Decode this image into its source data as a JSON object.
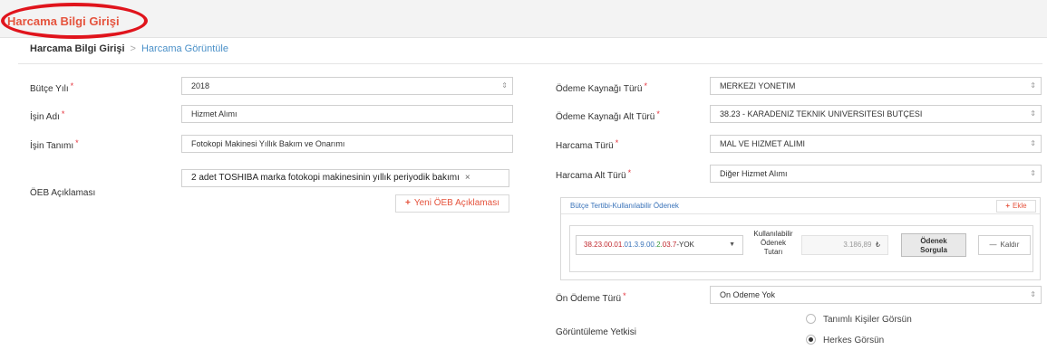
{
  "header": {
    "title": "Harcama Bilgi Girişi"
  },
  "breadcrumb": {
    "main": "Harcama Bilgi Girişi",
    "separator": ">",
    "current": "Harcama Görüntüle"
  },
  "required_mark": "*",
  "left_form": {
    "butce_yili": {
      "label": "Bütçe Yılı",
      "value": "2018"
    },
    "isin_adi": {
      "label": "İşin Adı",
      "value": "Hizmet Alımı"
    },
    "isin_tanimi": {
      "label": "İşin Tanımı",
      "value": "Fotokopi Makinesi Yıllık Bakım ve Onarımı"
    },
    "oeb": {
      "label": "ÖEB Açıklaması",
      "tag_text": "2 adet TOSHIBA marka fotokopi makinesinin yıllık periyodik bakımı",
      "tag_remove": "×",
      "new_button_plus": "+",
      "new_button_label": "Yeni ÖEB Açıklaması"
    }
  },
  "right_form": {
    "odeme_kaynagi_turu": {
      "label": "Ödeme Kaynağı Türü",
      "value": "MERKEZI YONETIM"
    },
    "odeme_kaynagi_alt_turu": {
      "label": "Ödeme Kaynağı Alt Türü",
      "value": "38.23 - KARADENIZ TEKNIK UNIVERSITESI BUTÇESI"
    },
    "harcama_turu": {
      "label": "Harcama Türü",
      "value": "MAL VE HIZMET ALIMI"
    },
    "harcama_alt_turu": {
      "label": "Harcama Alt Türü",
      "value": "Diğer Hizmet Alımı"
    },
    "on_odeme_turu": {
      "label": "Ön Ödeme Türü",
      "value": "On Odeme Yok"
    },
    "goruntuleme": {
      "label": "Görüntüleme Yetkisi",
      "options": [
        {
          "label": "Tanımlı Kişiler Görsün",
          "checked": false
        },
        {
          "label": "Herkes Görsün",
          "checked": true
        }
      ]
    }
  },
  "budget_panel": {
    "title": "Bütçe Tertibi-Kullanılabilir Ödenek",
    "add_plus": "+",
    "add_label": "Ekle",
    "code_parts": {
      "p1": "38.23.00.01.",
      "p2": "01.3.9.00.",
      "p3": "2.",
      "p4": "03.7",
      "p5": "-YOK"
    },
    "kod_label_line1": "Kullanılabilir",
    "kod_label_line2": "Ödenek",
    "kod_label_line3": "Tutarı",
    "amount": "3.186,89",
    "currency": "₺",
    "sorgula_line1": "Ödenek",
    "sorgula_line2": "Sorgula",
    "remove_label": "Kaldır",
    "remove_icon": "—"
  },
  "icons": {
    "select_arrow": "sort-arrows-icon",
    "dropdown": "caret-down-icon",
    "remove": "close-icon",
    "add": "plus-icon"
  },
  "colors": {
    "accent": "#e5533d",
    "link": "#4a90c8",
    "annotation_circle": "#e0141c"
  }
}
